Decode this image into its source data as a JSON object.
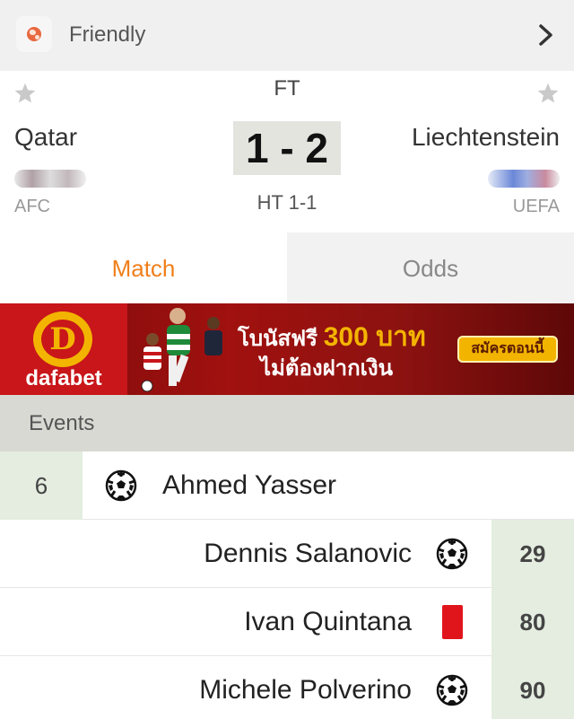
{
  "header": {
    "globe_icon": "globe-icon",
    "title": "Friendly",
    "chevron_icon": "chevron-right-icon"
  },
  "match": {
    "status": "FT",
    "home_team": "Qatar",
    "away_team": "Liechtenstein",
    "score": "1 - 2",
    "half_time": "HT 1-1",
    "home_confederation": "AFC",
    "away_confederation": "UEFA"
  },
  "tabs": [
    {
      "label": "Match",
      "active": true
    },
    {
      "label": "Odds",
      "active": false
    }
  ],
  "banner": {
    "logo_letter": "D",
    "brand": "dafabet",
    "line1_prefix": "โบนัสฟรี",
    "line1_amount": "300 บาท",
    "line2": "ไม่ต้องฝากเงิน",
    "cta": "สมัครตอนนี้"
  },
  "events": {
    "heading": "Events",
    "rows": [
      {
        "side": "home",
        "minute": "6",
        "player": "Ahmed Yasser",
        "type": "goal"
      },
      {
        "side": "away",
        "minute": "29",
        "player": "Dennis Salanovic",
        "type": "goal"
      },
      {
        "side": "away",
        "minute": "80",
        "player": "Ivan Quintana",
        "type": "red-card"
      },
      {
        "side": "away",
        "minute": "90",
        "player": "Michele Polverino",
        "type": "goal"
      }
    ]
  },
  "colors": {
    "accent": "#f07f1b",
    "minute_bg": "#e4ede0",
    "red_card": "#e0151c"
  }
}
